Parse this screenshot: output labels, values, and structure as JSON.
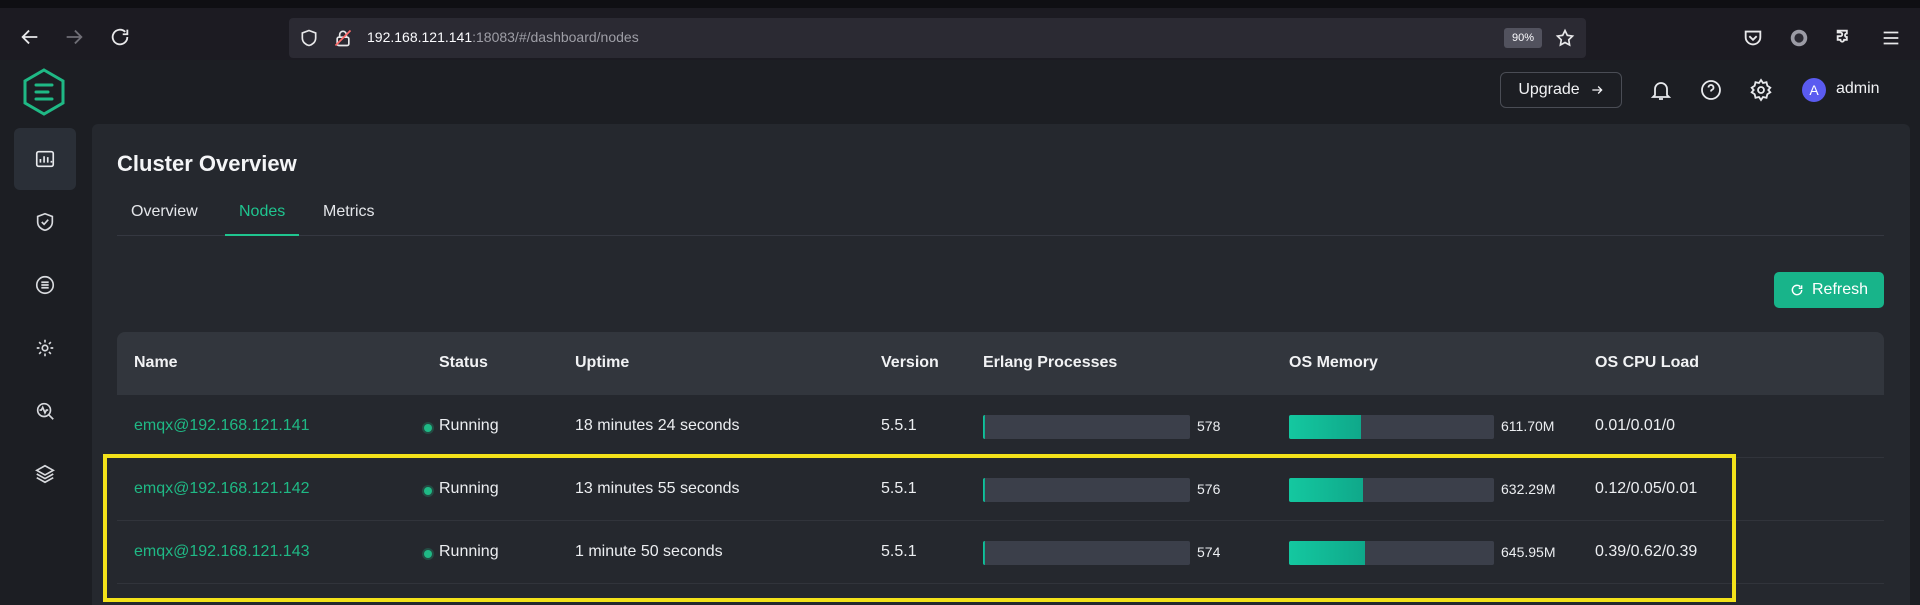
{
  "browser": {
    "url_host": "192.168.121.141",
    "url_rest": ":18083/#/dashboard/nodes",
    "zoom": "90%"
  },
  "topbar": {
    "upgrade_label": "Upgrade",
    "avatar_initial": "A",
    "user_name": "admin"
  },
  "page": {
    "title": "Cluster Overview",
    "tabs": [
      {
        "label": "Overview",
        "active": false
      },
      {
        "label": "Nodes",
        "active": true
      },
      {
        "label": "Metrics",
        "active": false
      }
    ],
    "refresh_label": "Refresh"
  },
  "table": {
    "headers": [
      "Name",
      "Status",
      "Uptime",
      "Version",
      "Erlang Processes",
      "OS Memory",
      "OS CPU Load"
    ],
    "rows": [
      {
        "name": "emqx@192.168.121.141",
        "status": "Running",
        "uptime": "18 minutes 24 seconds",
        "version": "5.5.1",
        "erlang_processes": "578",
        "erlang_fill": 0.01,
        "os_memory": "611.70M",
        "memory_fill": 0.35,
        "cpu_load": "0.01/0.01/0"
      },
      {
        "name": "emqx@192.168.121.142",
        "status": "Running",
        "uptime": "13 minutes 55 seconds",
        "version": "5.5.1",
        "erlang_processes": "576",
        "erlang_fill": 0.01,
        "os_memory": "632.29M",
        "memory_fill": 0.36,
        "cpu_load": "0.12/0.05/0.01"
      },
      {
        "name": "emqx@192.168.121.143",
        "status": "Running",
        "uptime": "1 minute 50 seconds",
        "version": "5.5.1",
        "erlang_processes": "574",
        "erlang_fill": 0.01,
        "os_memory": "645.95M",
        "memory_fill": 0.37,
        "cpu_load": "0.39/0.62/0.39"
      }
    ]
  },
  "colors": {
    "accent": "#1fb985",
    "highlight": "#f3e21a"
  }
}
